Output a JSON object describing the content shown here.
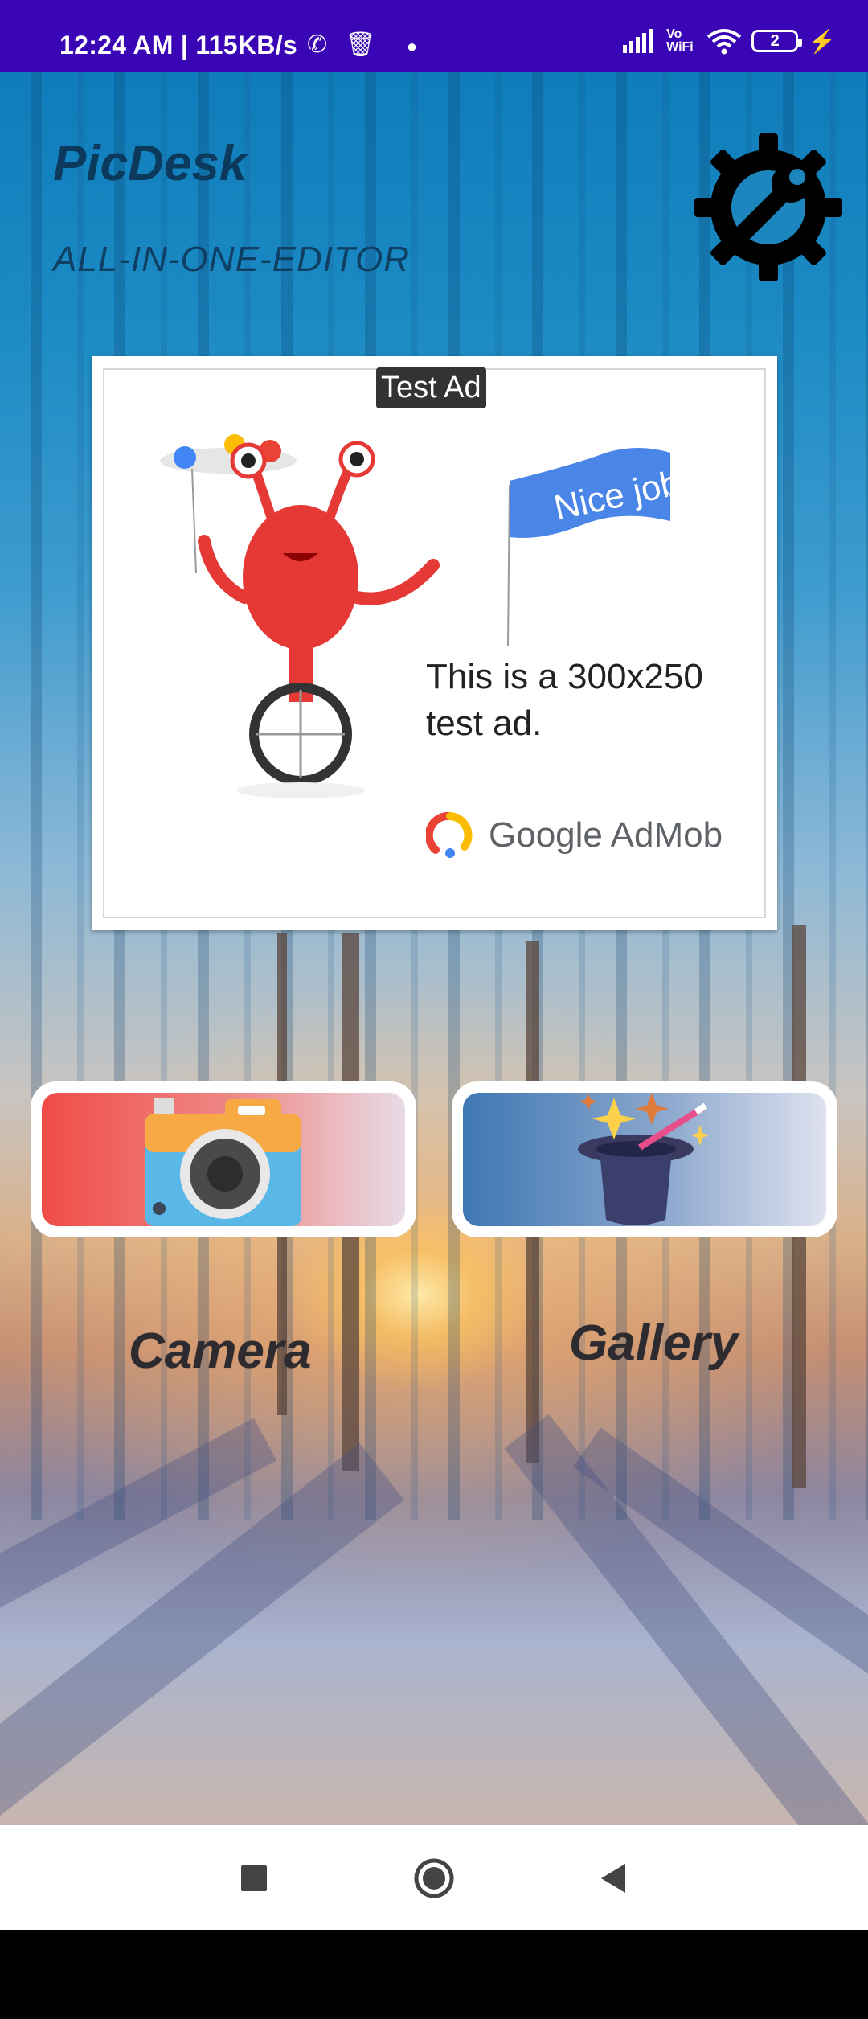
{
  "status_bar": {
    "time_speed": "12:24 AM | 115KB/s",
    "vowifi": "Vo WiFi",
    "battery_level": "2"
  },
  "header": {
    "app_title": "PicDesk",
    "subtitle": "ALL-IN-ONE-EDITOR",
    "settings_icon": "settings-wrench-gear-icon"
  },
  "ad": {
    "badge": "Test Ad",
    "banner_text": "Nice job!",
    "body_text": "This is a 300x250 test ad.",
    "brand": "Google AdMob"
  },
  "actions": {
    "camera_label": "Camera",
    "gallery_label": "Gallery",
    "camera_icon": "camera-icon",
    "gallery_icon": "magic-hat-icon"
  },
  "nav": {
    "recents_icon": "square-icon",
    "home_icon": "circle-icon",
    "back_icon": "triangle-back-icon"
  }
}
